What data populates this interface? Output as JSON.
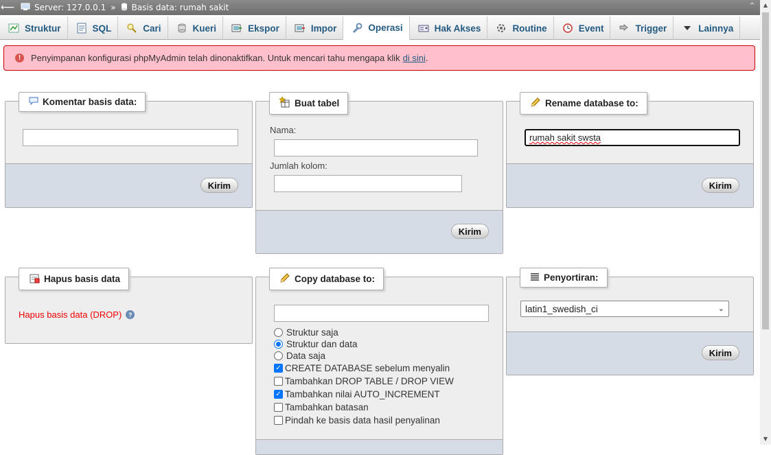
{
  "breadcrumb": {
    "server_label": "Server: 127.0.0.1",
    "sep": "»",
    "db_label": "Basis data: rumah sakit"
  },
  "tabs": [
    {
      "label": "Struktur",
      "icon": "structure-icon"
    },
    {
      "label": "SQL",
      "icon": "sql-icon"
    },
    {
      "label": "Cari",
      "icon": "search-icon"
    },
    {
      "label": "Kueri",
      "icon": "query-icon"
    },
    {
      "label": "Ekspor",
      "icon": "export-icon"
    },
    {
      "label": "Impor",
      "icon": "import-icon"
    },
    {
      "label": "Operasi",
      "icon": "wrench-icon"
    },
    {
      "label": "Hak Akses",
      "icon": "privileges-icon"
    },
    {
      "label": "Routine",
      "icon": "routine-icon"
    },
    {
      "label": "Event",
      "icon": "clock-icon"
    },
    {
      "label": "Trigger",
      "icon": "trigger-icon"
    },
    {
      "label": "Lainnya",
      "icon": "chevron-down-icon"
    }
  ],
  "notice": {
    "text": "Penyimpanan konfigurasi phpMyAdmin telah dinonaktifkan. Untuk mencari tahu mengapa klik",
    "link": "di sini",
    "tail": "."
  },
  "comment_panel": {
    "title": "Komentar basis data:",
    "value": "",
    "submit": "Kirim"
  },
  "create_table_panel": {
    "title": "Buat tabel",
    "name_label": "Nama:",
    "columns_label": "Jumlah kolom:",
    "submit": "Kirim"
  },
  "rename_panel": {
    "title": "Rename database to:",
    "value": "rumah sakit swsta",
    "submit": "Kirim"
  },
  "drop_panel": {
    "title": "Hapus basis data",
    "link": "Hapus basis data (DROP)"
  },
  "copy_panel": {
    "title": "Copy database to:",
    "radios": [
      {
        "label": "Struktur saja",
        "checked": false
      },
      {
        "label": "Struktur dan data",
        "checked": true
      },
      {
        "label": "Data saja",
        "checked": false
      }
    ],
    "checks": [
      {
        "label": "CREATE DATABASE sebelum menyalin",
        "checked": true
      },
      {
        "label": "Tambahkan DROP TABLE / DROP VIEW",
        "checked": false
      },
      {
        "label": "Tambahkan nilai AUTO_INCREMENT",
        "checked": true
      },
      {
        "label": "Tambahkan batasan",
        "checked": false
      },
      {
        "label": "Pindah ke basis data hasil penyalinan",
        "checked": false
      }
    ]
  },
  "collation_panel": {
    "title": "Penyortiran:",
    "selected": "latin1_swedish_ci",
    "submit": "Kirim"
  }
}
